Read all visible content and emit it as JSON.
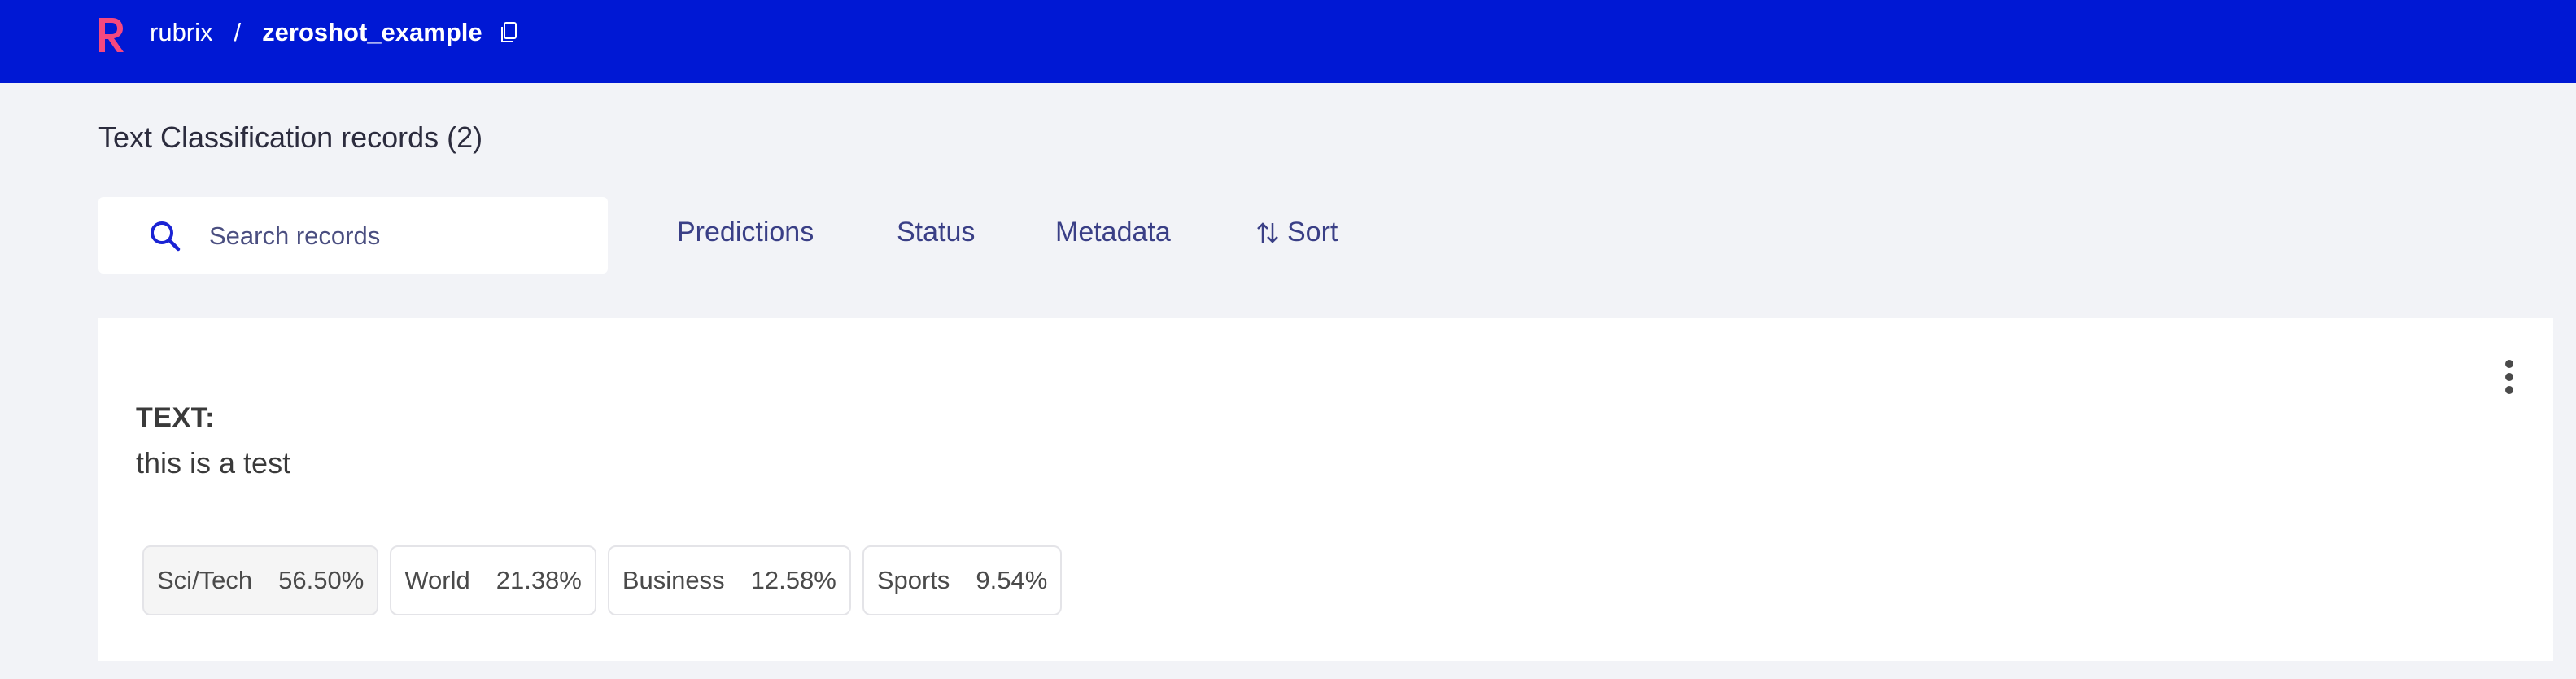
{
  "header": {
    "brand": "rubrix",
    "separator": "/",
    "dataset": "zeroshot_example"
  },
  "page_title": "Text Classification records (2)",
  "search": {
    "placeholder": "Search records",
    "value": ""
  },
  "filters": {
    "predictions": "Predictions",
    "status": "Status",
    "metadata": "Metadata",
    "sort": "Sort"
  },
  "record": {
    "text_label": "TEXT:",
    "text": "this is a test",
    "labels": [
      {
        "name": "Sci/Tech",
        "score": "56.50%"
      },
      {
        "name": "World",
        "score": "21.38%"
      },
      {
        "name": "Business",
        "score": "12.58%"
      },
      {
        "name": "Sports",
        "score": "9.54%"
      }
    ]
  },
  "colors": {
    "topbar": "#0018d4",
    "accent": "#3a3f86",
    "background": "#f2f3f7"
  }
}
